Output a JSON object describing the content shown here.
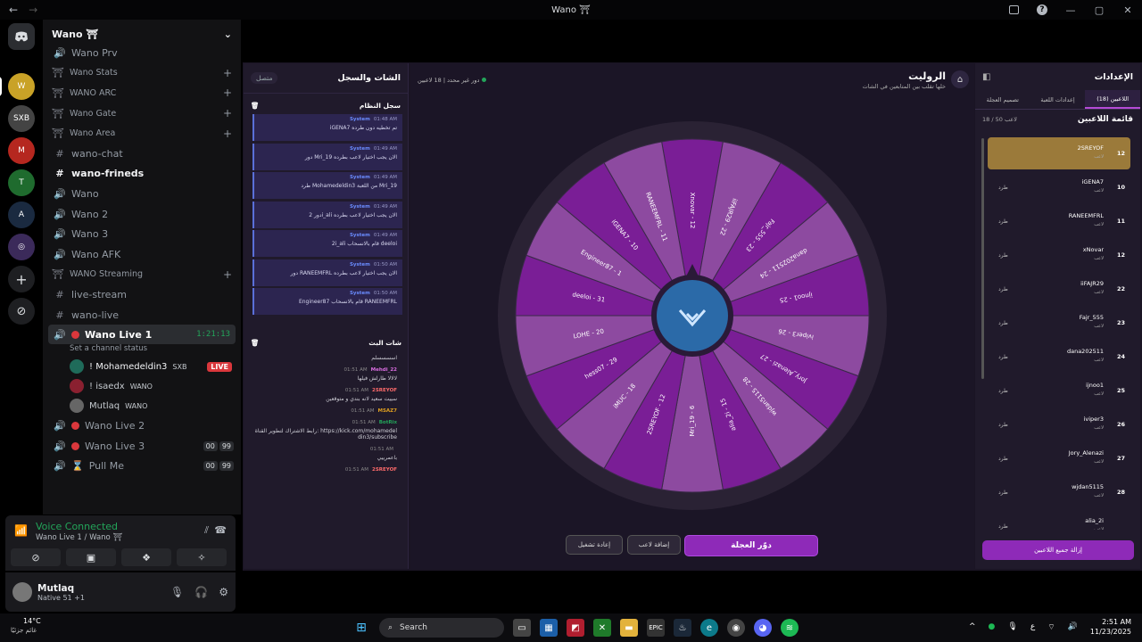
{
  "window": {
    "title": "Wano ⛩"
  },
  "server": {
    "name": "Wano ⛩"
  },
  "channels": [
    {
      "type": "voice",
      "name": "Wano Prv"
    },
    {
      "type": "cat",
      "name": "Wano Stats"
    },
    {
      "type": "cat",
      "name": "WANO ARC"
    },
    {
      "type": "cat",
      "name": "Wano Gate"
    },
    {
      "type": "cat",
      "name": "Wano Area"
    },
    {
      "type": "text",
      "name": "wano-chat"
    },
    {
      "type": "text",
      "name": "wano-frineds"
    },
    {
      "type": "voice",
      "name": "Wano"
    },
    {
      "type": "voice",
      "name": "Wano 2"
    },
    {
      "type": "voice",
      "name": "Wano 3"
    },
    {
      "type": "voice",
      "name": "Wano AFK"
    },
    {
      "type": "cat",
      "name": "WANO Streaming"
    },
    {
      "type": "text",
      "name": "live-stream"
    },
    {
      "type": "text",
      "name": "wano-live"
    }
  ],
  "live_channel": {
    "name": "Wano Live 1",
    "timer": "1:21:13",
    "status": "Set a channel status"
  },
  "live_users": [
    {
      "name": "! Mohamedeldin3",
      "tag": "SXB",
      "live": "LIVE"
    },
    {
      "name": "! isaedx",
      "tag": "WANO"
    },
    {
      "name": "Mutlaq",
      "tag": "WANO"
    }
  ],
  "more_channels": [
    {
      "name": "Wano Live 2"
    },
    {
      "name": "Wano Live 3",
      "c1": "00",
      "c2": "99"
    },
    {
      "name": "Pull Me",
      "c1": "00",
      "c2": "99"
    }
  ],
  "voice": {
    "title": "Voice Connected",
    "sub": "Wano Live 1 / Wano ⛩"
  },
  "user": {
    "name": "Mutlaq",
    "status": "Native 51 +1"
  },
  "left_panel": {
    "title": "الشات والسجل",
    "online": "متصل",
    "system_log": "سجل النظام",
    "bot_chat": "شات البث",
    "system_messages": [
      {
        "time": "01:48 AM",
        "from": "System",
        "text": "iGENA7 تم تخطيه دون طرده"
      },
      {
        "time": "01:49 AM",
        "from": "System",
        "text": "دور Mri_19 الان يجب اختيار لاعب بطرده"
      },
      {
        "time": "01:49 AM",
        "from": "System",
        "text": "طرد Mohamedeldin3 من اللعبة Mri_19"
      },
      {
        "time": "01:49 AM",
        "from": "System",
        "text": "دور 2i_ali الان يجب اختيار لاعب بطرده"
      },
      {
        "time": "01:49 AM",
        "from": "System",
        "text": "2i_ali قام بالانسحاب deeloi"
      },
      {
        "time": "01:50 AM",
        "from": "System",
        "text": "دور RANEEMFRL الان يجب اختيار لاعب بطرده"
      },
      {
        "time": "01:50 AM",
        "from": "System",
        "text": "Engineer87 قام بالانسحاب RANEEMFRL"
      }
    ],
    "chat_messages": [
      {
        "time": "",
        "from": "",
        "text": "اسسسسلم"
      },
      {
        "time": "01:51 AM",
        "from": "Mehdi_22",
        "text": "لالالا طارلش فيلها"
      },
      {
        "time": "01:51 AM",
        "from": "2SREYOF",
        "text": "سييت سعيد لانه بندي و متوقعين"
      },
      {
        "time": "01:51 AM",
        "from": "MSAZ7",
        "text": ""
      },
      {
        "time": "01:51 AM",
        "from": "BotRix",
        "text": "رابط الاشتراك لتطوير القناة: https://kick.com/mohamedeldin3/subscribe"
      },
      {
        "time": "01:51 AM",
        "from": "",
        "text": "باعمرييي"
      },
      {
        "time": "01:51 AM",
        "from": "2SREYOF",
        "text": ""
      }
    ]
  },
  "center": {
    "title": "الروليت",
    "subtitle": "خلها تقلب بين المتابعين في الشات",
    "players_count": "18 لاعبين",
    "turn": "دور غير محدد",
    "spin": "دوّر العجلة",
    "add_player": "إضافة لاعب",
    "replay": "إعادة تشغيل"
  },
  "wheel_segments": [
    "Xnovar - 12",
    "iiFAJR29 - 22",
    "Fajr_555 - 23",
    "dana202511 - 24",
    "ijnoo1 - 25",
    "iviper3 - 26",
    "Jory_Alenazi - 27",
    "wjdan5115 - 28",
    "alia_2i - 15",
    "Mri_19 - 6",
    "2SREYOF - 12",
    "iMUC - 18",
    "hess07 - 29",
    "LOHE - 20",
    "deeloi - 31",
    "Engineer87 - 1",
    "iGENA7 - 10",
    "RANEEMFRL - 11"
  ],
  "right_panel": {
    "title": "الإعدادات",
    "tabs": [
      "اللاعبين (18)",
      "إعدادات اللعبة",
      "تصميم العجلة"
    ],
    "list_title": "قائمة اللاعبين",
    "count": "18 / 50 لاعب",
    "remove_all": "إزالة جميع اللاعبين",
    "kick": "طرد",
    "state": "لاعب",
    "players": [
      {
        "name": "2SREYOF",
        "num": "12",
        "first": true
      },
      {
        "name": "iGENA7",
        "num": "10"
      },
      {
        "name": "RANEEMFRL",
        "num": "11"
      },
      {
        "name": "xNovar",
        "num": "12"
      },
      {
        "name": "iiFAJR29",
        "num": "22"
      },
      {
        "name": "Fajr_555",
        "num": "23"
      },
      {
        "name": "dana202511",
        "num": "24"
      },
      {
        "name": "ijnoo1",
        "num": "25"
      },
      {
        "name": "iviper3",
        "num": "26"
      },
      {
        "name": "Jory_Alenazi",
        "num": "27"
      },
      {
        "name": "wjdan5115",
        "num": "28"
      },
      {
        "name": "alia_2i",
        "num": ""
      }
    ]
  },
  "taskbar": {
    "temp": "14°C",
    "weather": "غائم جزئيًا",
    "search": "Search",
    "lang": "ع",
    "time": "2:51 AM",
    "date": "11/23/2025"
  },
  "colors": {
    "accent": "#8e2ab8",
    "seg_a": "#7a1e96",
    "seg_b": "#8d4aa0",
    "green": "#23a55a"
  }
}
